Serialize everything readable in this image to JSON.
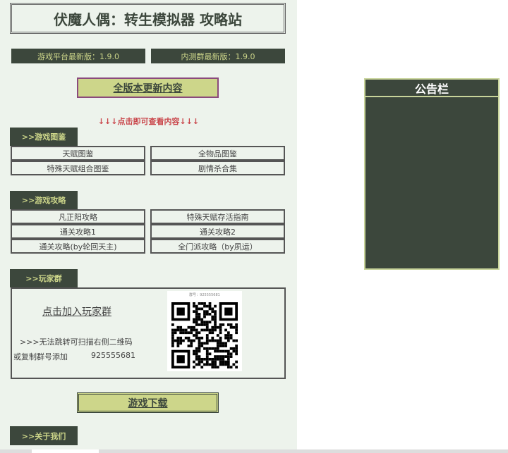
{
  "title": "伏魔人偶：转生模拟器 攻略站",
  "versions": [
    "游戏平台最新版：1.9.0",
    "内测群最新版：1.9.0"
  ],
  "update_button": "全版本更新内容",
  "hint": "↓↓↓点击即可查看内容↓↓↓",
  "sections": {
    "gallery": {
      "tab": ">>游戏图鉴",
      "items": [
        "天赋图鉴",
        "全物品图鉴",
        "特殊天赋组合图鉴",
        "剧情杀合集"
      ]
    },
    "guides": {
      "tab": ">>游戏攻略",
      "items": [
        "凡正阳攻略",
        "特殊天赋存活指南",
        "通关攻略1",
        "通关攻略2",
        "通关攻略(by轮回天主)",
        "全门派攻略（by夙运）"
      ]
    },
    "group": {
      "tab": ">>玩家群",
      "join": "点击加入玩家群",
      "line1": ">>>无法跳转可扫描右侧二维码",
      "line2": "或复制群号添加",
      "number": "925555681",
      "qr_label": "群号：925555681"
    },
    "about": {
      "tab": ">>关于我们"
    }
  },
  "download_button": "游戏下载",
  "announcement": {
    "title": "公告栏"
  }
}
